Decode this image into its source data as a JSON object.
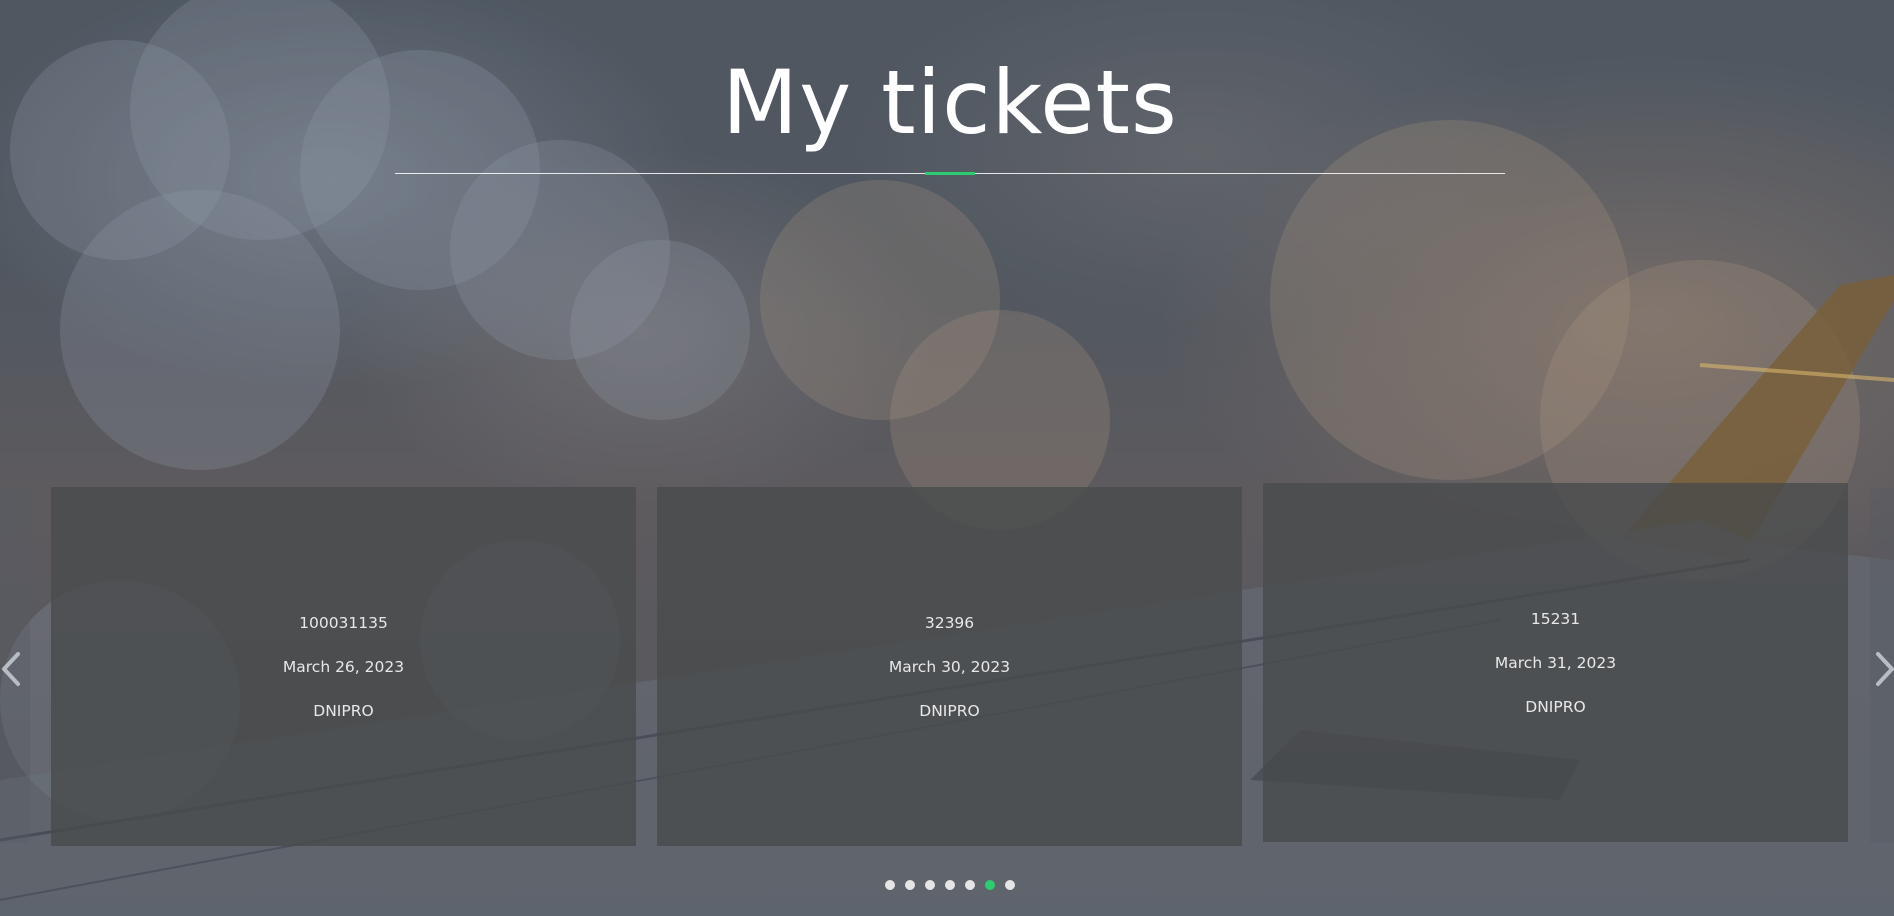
{
  "page": {
    "title": "My tickets"
  },
  "theme": {
    "accent": "#2ecc71",
    "card_background": "#484a4c",
    "text_color": "#e8e8e8"
  },
  "carousel": {
    "prev_icon": "chevron-left-icon",
    "next_icon": "chevron-right-icon",
    "tickets": [
      {
        "number": "100031135",
        "date": "March 26, 2023",
        "city": "DNIPRO"
      },
      {
        "number": "32396",
        "date": "March 30, 2023",
        "city": "DNIPRO"
      },
      {
        "number": "15231",
        "date": "March 31, 2023",
        "city": "DNIPRO"
      }
    ],
    "pagination": {
      "total": 7,
      "active_index": 5
    }
  }
}
